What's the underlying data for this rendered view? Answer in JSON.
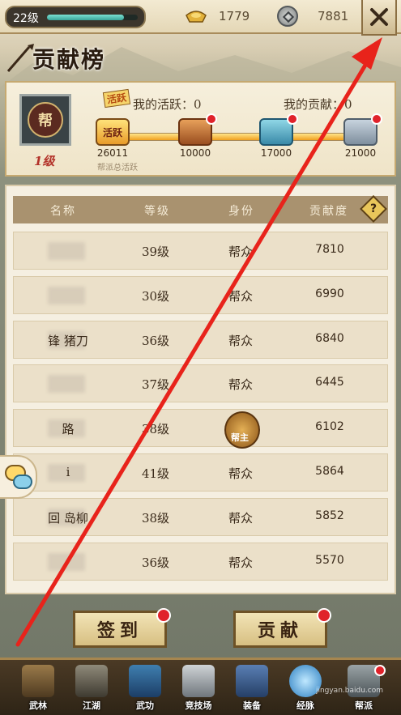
{
  "topbar": {
    "level": "22级",
    "xp_fraction": 0.85,
    "gold": "1779",
    "coins": "7881",
    "close_glyph": "✕"
  },
  "title": "贡献榜",
  "activity": {
    "badge": "活跃",
    "my_activity_label": "我的活跃：0",
    "my_contribution_label": "我的贡献：0",
    "guild_level": "1级",
    "guild_emblem": "帮",
    "total_caption": "帮派总活跃",
    "current_icon": "活跃",
    "current_value": "26011",
    "milestones": [
      {
        "value": "10000",
        "chest": "gold"
      },
      {
        "value": "17000",
        "chest": "blue"
      },
      {
        "value": "21000",
        "chest": "silver"
      }
    ],
    "progress_fraction": 1.0
  },
  "table": {
    "headers": [
      "名称",
      "等级",
      "身份",
      "贡献度"
    ],
    "help": "?",
    "rows": [
      {
        "name": "",
        "level": "39级",
        "role": "帮众",
        "points": "7810"
      },
      {
        "name": "",
        "level": "30级",
        "role": "帮众",
        "points": "6990"
      },
      {
        "name": "锋        猪刀",
        "level": "36级",
        "role": "帮众",
        "points": "6840"
      },
      {
        "name": "",
        "level": "37级",
        "role": "帮众",
        "points": "6445"
      },
      {
        "name": "        路",
        "level": "38级",
        "role": "帮主",
        "points": "6102"
      },
      {
        "name": "        i",
        "level": "41级",
        "role": "帮众",
        "points": "5864"
      },
      {
        "name": "回        岛柳",
        "level": "38级",
        "role": "帮众",
        "points": "5852"
      },
      {
        "name": "",
        "level": "36级",
        "role": "帮众",
        "points": "5570"
      }
    ]
  },
  "buttons": {
    "signin": "签到",
    "contribute": "贡献"
  },
  "nav": [
    {
      "label": "武林",
      "icon": "pagoda-icon"
    },
    {
      "label": "江湖",
      "icon": "swordsman-icon"
    },
    {
      "label": "武功",
      "icon": "scroll-icon"
    },
    {
      "label": "竞技场",
      "icon": "crossed-swords-icon"
    },
    {
      "label": "装备",
      "icon": "armor-icon"
    },
    {
      "label": "经脉",
      "icon": "orb-icon"
    },
    {
      "label": "帮派",
      "icon": "guild-icon"
    }
  ],
  "watermark": "jingyan.baidu.com",
  "colors": {
    "accent_red": "#e0222a",
    "annotation": "#e8231b"
  }
}
